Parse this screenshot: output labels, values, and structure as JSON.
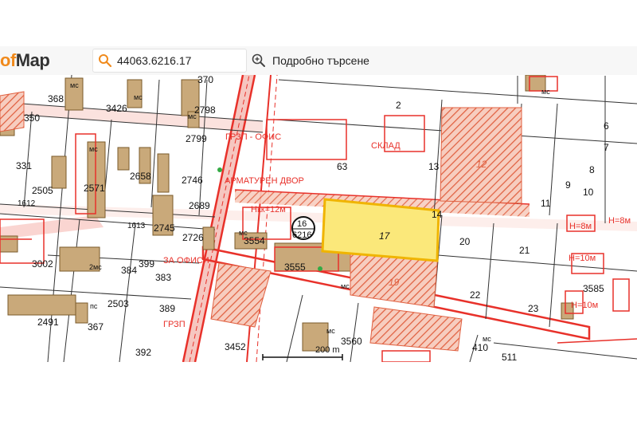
{
  "app": {
    "logo_prefix": "of",
    "logo_main": "Map"
  },
  "search": {
    "value": "44063.6216.17",
    "placeholder": ""
  },
  "advanced_search": {
    "label": "Подробно търсене"
  },
  "map": {
    "scale_label": "200 m",
    "selected_parcel": {
      "number": "17",
      "block_top": "16",
      "block_bottom": "6216"
    },
    "zone_labels": [
      "ГРЗП - ОФИС",
      "ЗА ОФИСИ",
      "ГРЗП",
      "СКЛАД",
      "АРМАТУРЕН ДВОР",
      "Нкк=12м",
      "H=8м",
      "H=10м",
      "H=10м",
      "H=8м"
    ],
    "parcel_labels": [
      "370",
      "368",
      "3426",
      "2798",
      "350",
      "2799",
      "331",
      "2505",
      "2571",
      "2658",
      "2746",
      "2689",
      "1612",
      "1613",
      "2745",
      "2726",
      "3554",
      "3555",
      "3002",
      "399",
      "384",
      "383",
      "2503",
      "2491",
      "367",
      "389",
      "392",
      "3452",
      "3560",
      "410",
      "2",
      "6",
      "7",
      "8",
      "9",
      "10",
      "11",
      "12",
      "13",
      "14",
      "19",
      "20",
      "21",
      "22",
      "23",
      "63",
      "3585",
      "511"
    ],
    "small_labels": [
      "мс",
      "мс",
      "мс",
      "мс",
      "мс",
      "2мс",
      "пс",
      "мс",
      "мс",
      "мс",
      "мс"
    ],
    "colors": {
      "zone_red": "#e8312a",
      "building_fill": "#c9a97a",
      "building_stroke": "#7a5a2a",
      "selected_fill": "#fbe87a",
      "selected_stroke": "#f0b400",
      "hatch": "#e06040",
      "road_pink": "#f4b8b0",
      "parcel_line": "#333333",
      "pin": "#33aa44"
    }
  }
}
